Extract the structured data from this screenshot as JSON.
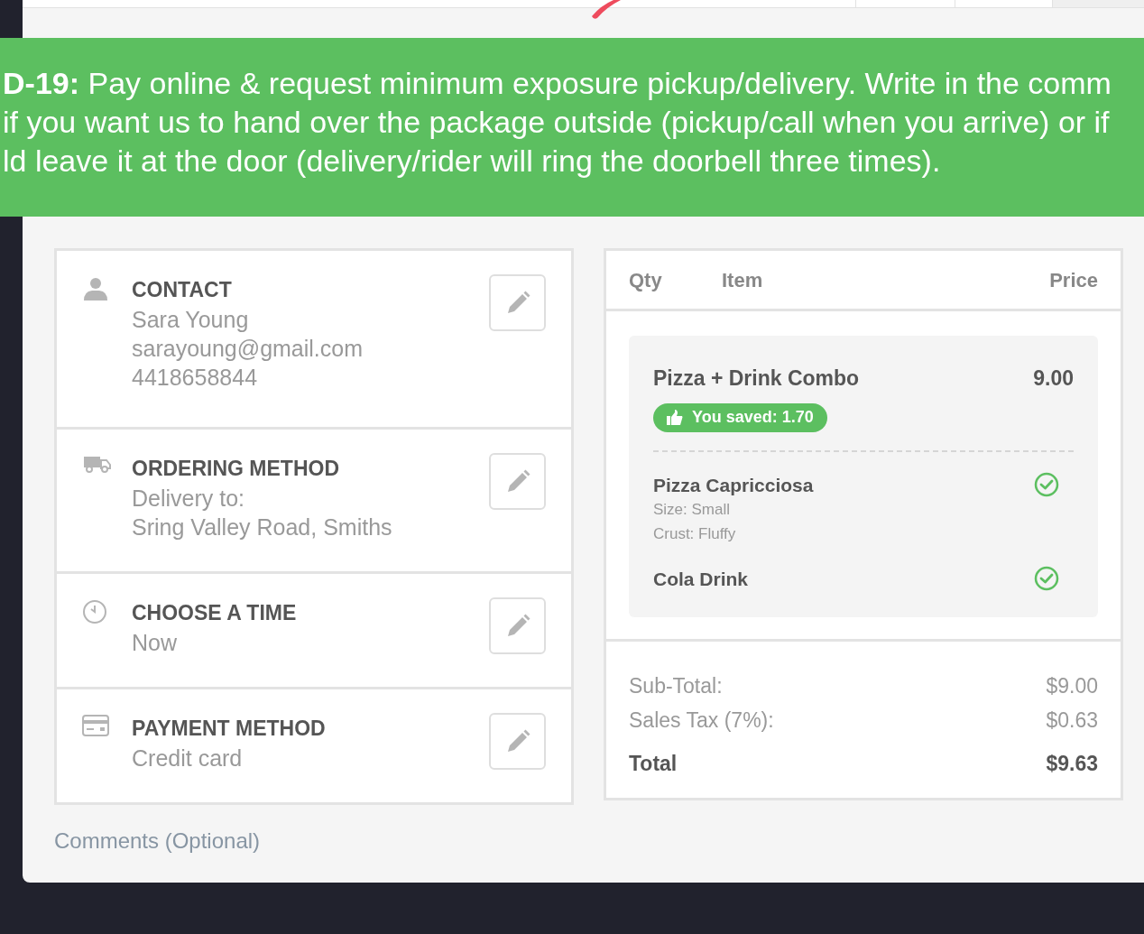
{
  "banner": {
    "lines": [
      "**D-19:** Pay online & request minimum exposure pickup/delivery. Write in the comm",
      "if you want us to hand over the package outside (pickup/call when you arrive) or if",
      "ld leave it at the door (delivery/rider will ring the doorbell three times)."
    ]
  },
  "sections": [
    {
      "kind": "contact",
      "title": "CONTACT",
      "lines": [
        "Sara Young",
        "sarayoung@gmail.com",
        "4418658844"
      ]
    },
    {
      "kind": "ordering",
      "title": "ORDERING METHOD",
      "lines": [
        "Delivery to:",
        "Sring Valley Road, Smiths"
      ]
    },
    {
      "kind": "time",
      "title": "CHOOSE A TIME",
      "lines": [
        "Now"
      ]
    },
    {
      "kind": "payment",
      "title": "PAYMENT METHOD",
      "lines": [
        "Credit card"
      ]
    }
  ],
  "order": {
    "columns": [
      "Qty",
      "Item",
      "Price"
    ],
    "combo": {
      "name": "Pizza + Drink Combo",
      "price": "9.00",
      "savings": "You saved: 1.70",
      "components": [
        {
          "name": "Pizza Capricciosa",
          "details": [
            "Size: Small",
            "Crust: Fluffy"
          ],
          "checked": true
        },
        {
          "name": "Cola Drink",
          "checked": true
        }
      ]
    },
    "totals": [
      {
        "label": "Sub-Total:",
        "value": "$9.00",
        "kind": "line"
      },
      {
        "label": "Sales Tax (7%):",
        "value": "$0.63",
        "kind": "line"
      },
      {
        "label": "Total",
        "value": "$9.63",
        "kind": "total"
      }
    ]
  },
  "comments_label": "Comments (Optional)"
}
